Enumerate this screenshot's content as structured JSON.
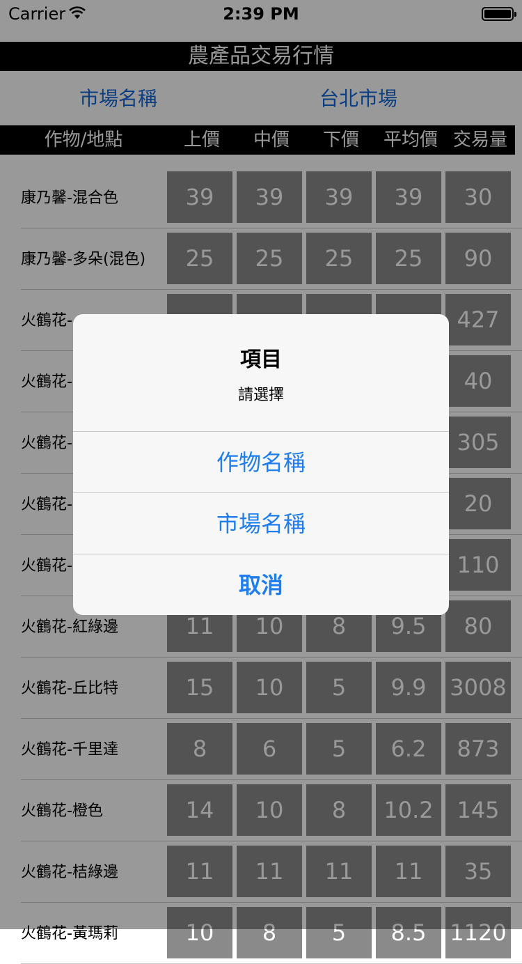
{
  "status_bar": {
    "carrier": "Carrier",
    "time": "2:39 PM"
  },
  "header": {
    "title": "農產品交易行情"
  },
  "market": {
    "label": "市場名稱",
    "value": "台北市場"
  },
  "columns": [
    "作物/地點",
    "上價",
    "中價",
    "下價",
    "平均價",
    "交易量"
  ],
  "rows": [
    {
      "name": "康乃馨-混合色",
      "values": [
        "39",
        "39",
        "39",
        "39",
        "30"
      ]
    },
    {
      "name": "康乃馨-多朵(混色)",
      "values": [
        "25",
        "25",
        "25",
        "25",
        "90"
      ]
    },
    {
      "name": "火鶴花-",
      "values": [
        "",
        "",
        "",
        "",
        "427"
      ]
    },
    {
      "name": "火鶴花-",
      "values": [
        "",
        "",
        "",
        "",
        "40"
      ]
    },
    {
      "name": "火鶴花-",
      "values": [
        "",
        "",
        "",
        "",
        "305"
      ]
    },
    {
      "name": "火鶴花-",
      "values": [
        "",
        "",
        "",
        "",
        "20"
      ]
    },
    {
      "name": "火鶴花-",
      "values": [
        "",
        "",
        "",
        "",
        "110"
      ]
    },
    {
      "name": "火鶴花-紅綠邊",
      "values": [
        "11",
        "10",
        "8",
        "9.5",
        "80"
      ]
    },
    {
      "name": "火鶴花-丘比特",
      "values": [
        "15",
        "10",
        "5",
        "9.9",
        "3008"
      ]
    },
    {
      "name": "火鶴花-千里達",
      "values": [
        "8",
        "6",
        "5",
        "6.2",
        "873"
      ]
    },
    {
      "name": "火鶴花-橙色",
      "values": [
        "14",
        "10",
        "8",
        "10.2",
        "145"
      ]
    },
    {
      "name": "火鶴花-桔綠邊",
      "values": [
        "11",
        "11",
        "11",
        "11",
        "35"
      ]
    },
    {
      "name": "火鶴花-黃瑪莉",
      "values": [
        "10",
        "8",
        "5",
        "8.5",
        "1120"
      ]
    }
  ],
  "alert": {
    "title": "項目",
    "message": "請選擇",
    "buttons": [
      "作物名稱",
      "市場名稱",
      "取消"
    ]
  }
}
